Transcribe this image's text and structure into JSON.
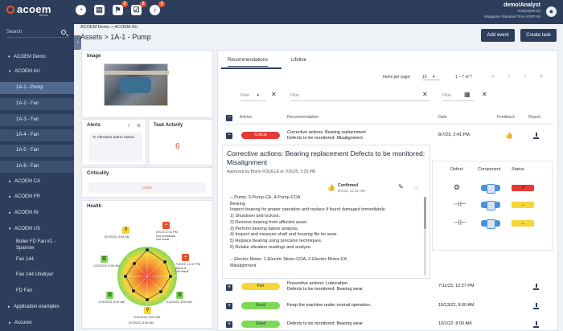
{
  "app": {
    "logo": "acoem",
    "logo_sub": "eboco",
    "badges": [
      "3",
      "2",
      "3"
    ],
    "user_name": "demo/Analyst",
    "user_role": "Analyst(demo)",
    "user_tz": "Singapore Standard Time (GMT+8)",
    "accent": "#e8542d",
    "navy": "#2d3e5c"
  },
  "sidebar": {
    "search_label": "Search",
    "items": [
      {
        "label": "ACOEM Demo"
      },
      {
        "label": "ACOEM AU"
      },
      {
        "label": "1A-1 - Pump"
      },
      {
        "label": "1A-2 - Fan"
      },
      {
        "label": "1A-3 - Fan"
      },
      {
        "label": "1A-4 - Fan"
      },
      {
        "label": "1A-5 - Fan"
      },
      {
        "label": "1A-6 - Fan"
      },
      {
        "label": "ACOEM CA"
      },
      {
        "label": "ACOEM FR"
      },
      {
        "label": "ACOEM IN"
      },
      {
        "label": "ACOEM US"
      },
      {
        "label": "Boiler FD Fan #1 - Sparrow"
      },
      {
        "label": "Fan 144"
      },
      {
        "label": "Fan 144 Unidryer"
      },
      {
        "label": "FD Fan"
      },
      {
        "label": "Application examples"
      },
      {
        "label": "Accurex"
      }
    ]
  },
  "header": {
    "breadcrumb": "ACOEM Demo > ACOEM AU",
    "title": "Assets > 1A-1 - Pump",
    "add_event": "Add event",
    "create_task": "Create task"
  },
  "left": {
    "image_title": "Image",
    "alerts_title": "Alerts",
    "alert_text": "% Vibration alarm status",
    "task_title": "Task Activity",
    "task_value": "6",
    "criticality_title": "Criticality",
    "criticality_value": "HIGH",
    "health_title": "Health",
    "health_labels": [
      "9/7/2023, 9:00 AM",
      "8/7/23, 2:41 PM\nNot scheduled\nGet result",
      "1/11/2023, 8:00 AM",
      "7/10/23, 12:37 PM\nAlarm 5\nGet result",
      "1/13/2023, 8:00 AM",
      "1/11/2023, 8:00 AM",
      "1/13/2023, 8:00 AM",
      "9/7/2023, 8:00 AM"
    ]
  },
  "tabs": [
    "Recommendations",
    "Lifeline"
  ],
  "pager": {
    "label": "Items per page:",
    "per_page": "10",
    "range": "1 – 7 of 7"
  },
  "filters": {
    "filter1": "Filter",
    "filter2": "Filter",
    "filter3": "Filter"
  },
  "table": {
    "headers": [
      "Advice",
      "Recommendation",
      "Date",
      "Feedback",
      "Report"
    ],
    "rows": [
      {
        "advice": "Critical",
        "color": "#e53935",
        "text1": "Corrective actions: Bearing replacement",
        "text2": "Defects to be monitored: Misalignment",
        "date": "8/7/23, 2:41 PM"
      },
      {
        "advice": "Fair",
        "color": "#f5d53a",
        "text1": "Preventive actions: Lubrication",
        "text2": "Defects to be monitored: Bearing wear",
        "date": "7/11/23, 12:37 PM"
      },
      {
        "advice": "Good",
        "color": "#7ed957",
        "text1": "Keep the machine under normal operation.",
        "text2": "",
        "date": "10/13/22, 8:00 AM"
      },
      {
        "advice": "Good",
        "color": "#7ed957",
        "text1": "Defects to be monitored: Bearing wear",
        "text2": "",
        "date": "10/1/22, 8:00 AM"
      }
    ]
  },
  "detail": {
    "title": "Corrective actions: Bearing replacement Defects to be monitored: Misalignment",
    "approved": "Approved by Bruno FOUILLE at 7/16/25, 3:33 PM",
    "confirmed": "Confirmed",
    "confirmed_date": "8/1/23, 11:32 AM",
    "body": "-- Pump: 3-Pump-CA, 4-Pump-COA\nBearing\nInspect bearing for proper operation and replace if found damaged immediately.\n1) Shutdown and lockout.\n2) Remove bearing from affected asset.\n3) Perform bearing failure analysis.\n4) Inspect and measure shaft and housing fits for wear.\n5) Replace bearing using precision techniques.\n6) Retake vibration readings and analyse.\n\n-- Electric Motor: 1-Electric Motor-COA, 2-Electric Motor-CA\nMisalignment",
    "panel_headers": [
      "Defect",
      "Component",
      "Status"
    ]
  }
}
